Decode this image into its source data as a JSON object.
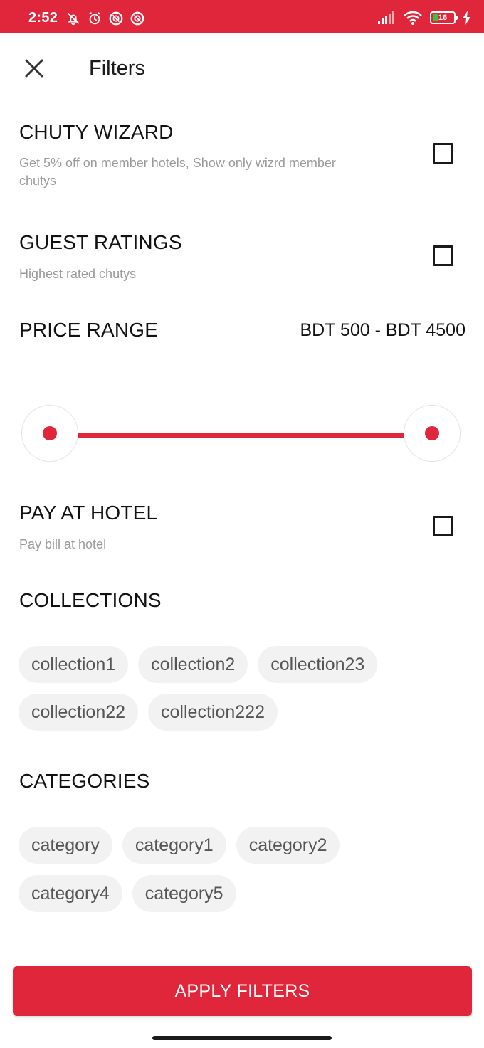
{
  "status_bar": {
    "time": "2:52",
    "battery_level": "16",
    "icons": [
      "bell-off-icon",
      "alarm-icon",
      "circle-block-icon",
      "circle-block-icon",
      "signal-icon",
      "wifi-icon",
      "battery-icon",
      "charging-bolt-icon"
    ],
    "color": "#e0263a"
  },
  "header": {
    "close_icon": "close-icon",
    "title": "Filters"
  },
  "filters": {
    "chuty_wizard": {
      "title": "CHUTY WIZARD",
      "subtitle_line1": "Get 5% off on member hotels, Show only wizrd member",
      "subtitle_line2": "chutys",
      "checked": false
    },
    "guest_ratings": {
      "title": "GUEST RATINGS",
      "subtitle": "Highest rated chutys",
      "checked": false
    },
    "price_range": {
      "title": "PRICE RANGE",
      "value_text": "BDT 500 - BDT 4500",
      "min": 500,
      "max": 4500,
      "low_fraction": 0.0,
      "high_fraction": 1.0
    },
    "pay_at_hotel": {
      "title": "PAY AT HOTEL",
      "subtitle": "Pay bill at hotel",
      "checked": false
    },
    "collections": {
      "title": "COLLECTIONS",
      "row1": [
        "collection1",
        "collection2",
        "collection23"
      ],
      "row2": [
        "collection22",
        "collection222"
      ]
    },
    "categories": {
      "title": "CATEGORIES",
      "row1": [
        "category",
        "category1",
        "category2"
      ],
      "row2": [
        "category4",
        "category5"
      ]
    }
  },
  "apply_button": {
    "label": "APPLY FILTERS"
  },
  "accent_color": "#e0263a"
}
